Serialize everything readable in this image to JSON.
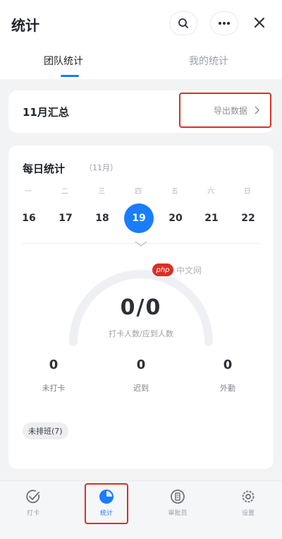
{
  "header": {
    "title": "统计",
    "icons": {
      "search": "search-icon",
      "more": "more-icon",
      "close": "close-icon"
    }
  },
  "tabs": [
    {
      "label": "团队统计",
      "active": true
    },
    {
      "label": "我的统计",
      "active": false
    }
  ],
  "summary": {
    "title": "11月汇总",
    "export_label": "导出数据"
  },
  "daily": {
    "title": "每日统计",
    "month_tag": "（11月）",
    "week": [
      {
        "weekday": "一",
        "day": "16"
      },
      {
        "weekday": "二",
        "day": "17"
      },
      {
        "weekday": "三",
        "day": "18"
      },
      {
        "weekday": "四",
        "day": "19",
        "selected": true
      },
      {
        "weekday": "五",
        "day": "20"
      },
      {
        "weekday": "六",
        "day": "21"
      },
      {
        "weekday": "日",
        "day": "22"
      }
    ],
    "gauge": {
      "value_text": "0/0",
      "caption": "打卡人数/应到人数",
      "fraction": 0
    },
    "stats": [
      {
        "value": "0",
        "label": "未打卡"
      },
      {
        "value": "0",
        "label": "迟到"
      },
      {
        "value": "0",
        "label": "外勤"
      }
    ],
    "chip": "未排班(7)"
  },
  "watermark": {
    "logo": "php",
    "text": "中文网"
  },
  "bottom_nav": [
    {
      "label": "打卡",
      "icon": "check-icon",
      "active": false
    },
    {
      "label": "统计",
      "icon": "chart-icon",
      "active": true
    },
    {
      "label": "审批员",
      "icon": "approval-icon",
      "active": false
    },
    {
      "label": "设置",
      "icon": "settings-icon",
      "active": false
    }
  ],
  "colors": {
    "accent": "#1a7cff",
    "highlight_box": "#d93025",
    "background": "#f2f3f5"
  }
}
